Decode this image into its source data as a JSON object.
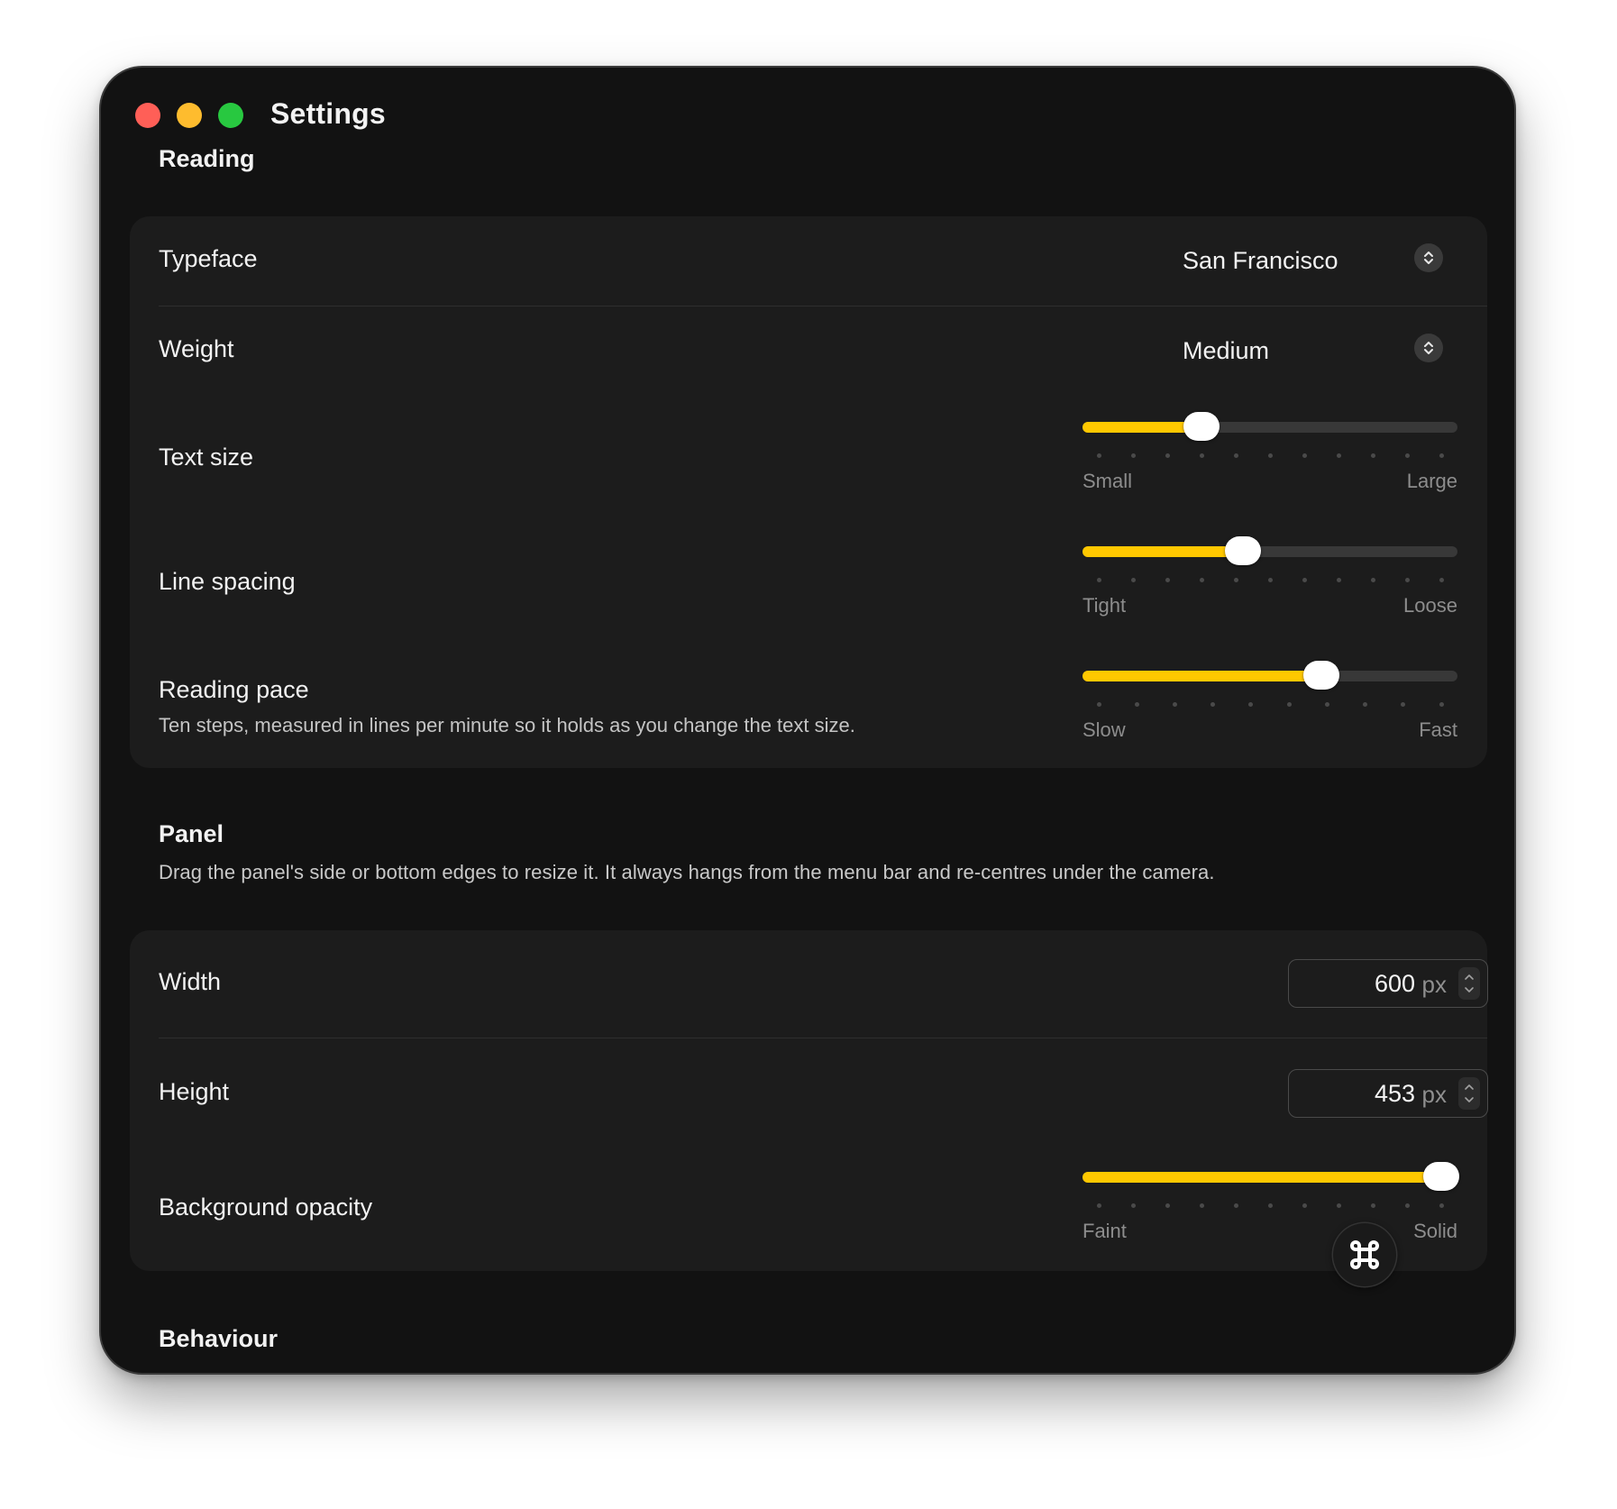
{
  "window": {
    "title": "Settings"
  },
  "reading": {
    "heading": "Reading",
    "typeface": {
      "label": "Typeface",
      "value": "San Francisco"
    },
    "weight": {
      "label": "Weight",
      "value": "Medium"
    },
    "text_size": {
      "label": "Text size",
      "min_label": "Small",
      "max_label": "Large",
      "value_fraction": 0.3,
      "steps": 11
    },
    "line_spacing": {
      "label": "Line spacing",
      "min_label": "Tight",
      "max_label": "Loose",
      "value_fraction": 0.42,
      "steps": 11
    },
    "reading_pace": {
      "label": "Reading pace",
      "description": "Ten steps, measured in lines per minute so it holds as you change the text size.",
      "min_label": "Slow",
      "max_label": "Fast",
      "value_fraction": 0.65,
      "steps": 10
    }
  },
  "panel": {
    "heading": "Panel",
    "description": "Drag the panel's side or bottom edges to resize it. It always hangs from the menu bar and re-centres under the camera.",
    "width": {
      "label": "Width",
      "value": "600",
      "unit": "px"
    },
    "height": {
      "label": "Height",
      "value": "453",
      "unit": "px"
    },
    "background_opacity": {
      "label": "Background opacity",
      "min_label": "Faint",
      "max_label": "Solid",
      "value_fraction": 1.0,
      "steps": 11
    }
  },
  "behaviour": {
    "heading": "Behaviour"
  },
  "colors": {
    "accent": "#ffc800",
    "window_bg": "#121212",
    "card_bg": "#1c1c1c"
  },
  "icons": {
    "popup": "chevron-up-down-icon",
    "stepper": "stepper-arrows-icon",
    "fab": "command-key-icon"
  }
}
